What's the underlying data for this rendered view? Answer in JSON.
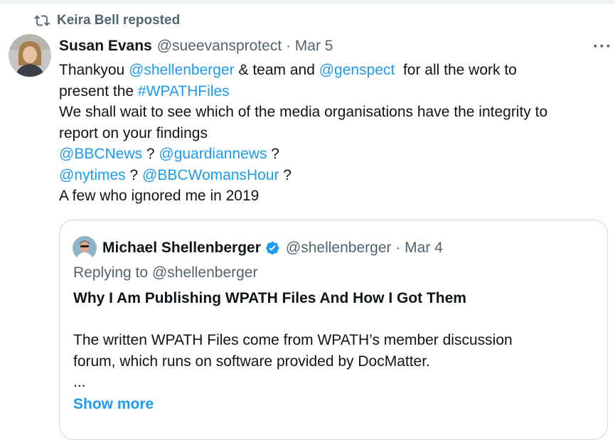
{
  "repost": {
    "label": "Keira Bell reposted",
    "icon": "repost-icon"
  },
  "tweet": {
    "author_name": "Susan Evans",
    "handle_date": "@sueevansprotect · Mar 5",
    "more_icon": "···",
    "lines": [
      {
        "parts": [
          {
            "text": "Thankyou ",
            "link": false
          },
          {
            "text": "@shellenberger",
            "link": true
          },
          {
            "text": " & team and ",
            "link": false
          },
          {
            "text": "@genspect",
            "link": true
          },
          {
            "text": "  for all the work to",
            "link": false
          }
        ]
      },
      {
        "parts": [
          {
            "text": "present the ",
            "link": false
          },
          {
            "text": "#WPATHFiles",
            "link": true
          }
        ]
      },
      {
        "parts": [
          {
            "text": "We shall wait to see which of the media organisations have the integrity to",
            "link": false
          }
        ]
      },
      {
        "parts": [
          {
            "text": "report on your findings",
            "link": false
          }
        ]
      },
      {
        "parts": [
          {
            "text": "@BBCNews",
            "link": true
          },
          {
            "text": " ? ",
            "link": false
          },
          {
            "text": "@guardiannews",
            "link": true
          },
          {
            "text": " ?",
            "link": false
          }
        ]
      },
      {
        "parts": [
          {
            "text": "@nytimes",
            "link": true
          },
          {
            "text": " ? ",
            "link": false
          },
          {
            "text": "@BBCWomansHour",
            "link": true
          },
          {
            "text": " ?",
            "link": false
          }
        ]
      },
      {
        "parts": [
          {
            "text": "A few who ignored me in 2019",
            "link": false
          }
        ]
      }
    ]
  },
  "quote": {
    "author_name": "Michael Shellenberger",
    "handle_date": "@shellenberger · Mar 4",
    "replying_to": "Replying to @shellenberger",
    "title": "Why I Am Publishing WPATH Files And How I Got Them",
    "body_lines": [
      "The written WPATH Files come from WPATH’s member discussion",
      "forum, which runs on software provided by DocMatter."
    ],
    "ellipsis": "...",
    "show_more": "Show more"
  },
  "colors": {
    "link": "#1d9bf0",
    "secondary_text": "#536471",
    "primary_text": "#0f1419",
    "verified": "#1d9bf0"
  }
}
